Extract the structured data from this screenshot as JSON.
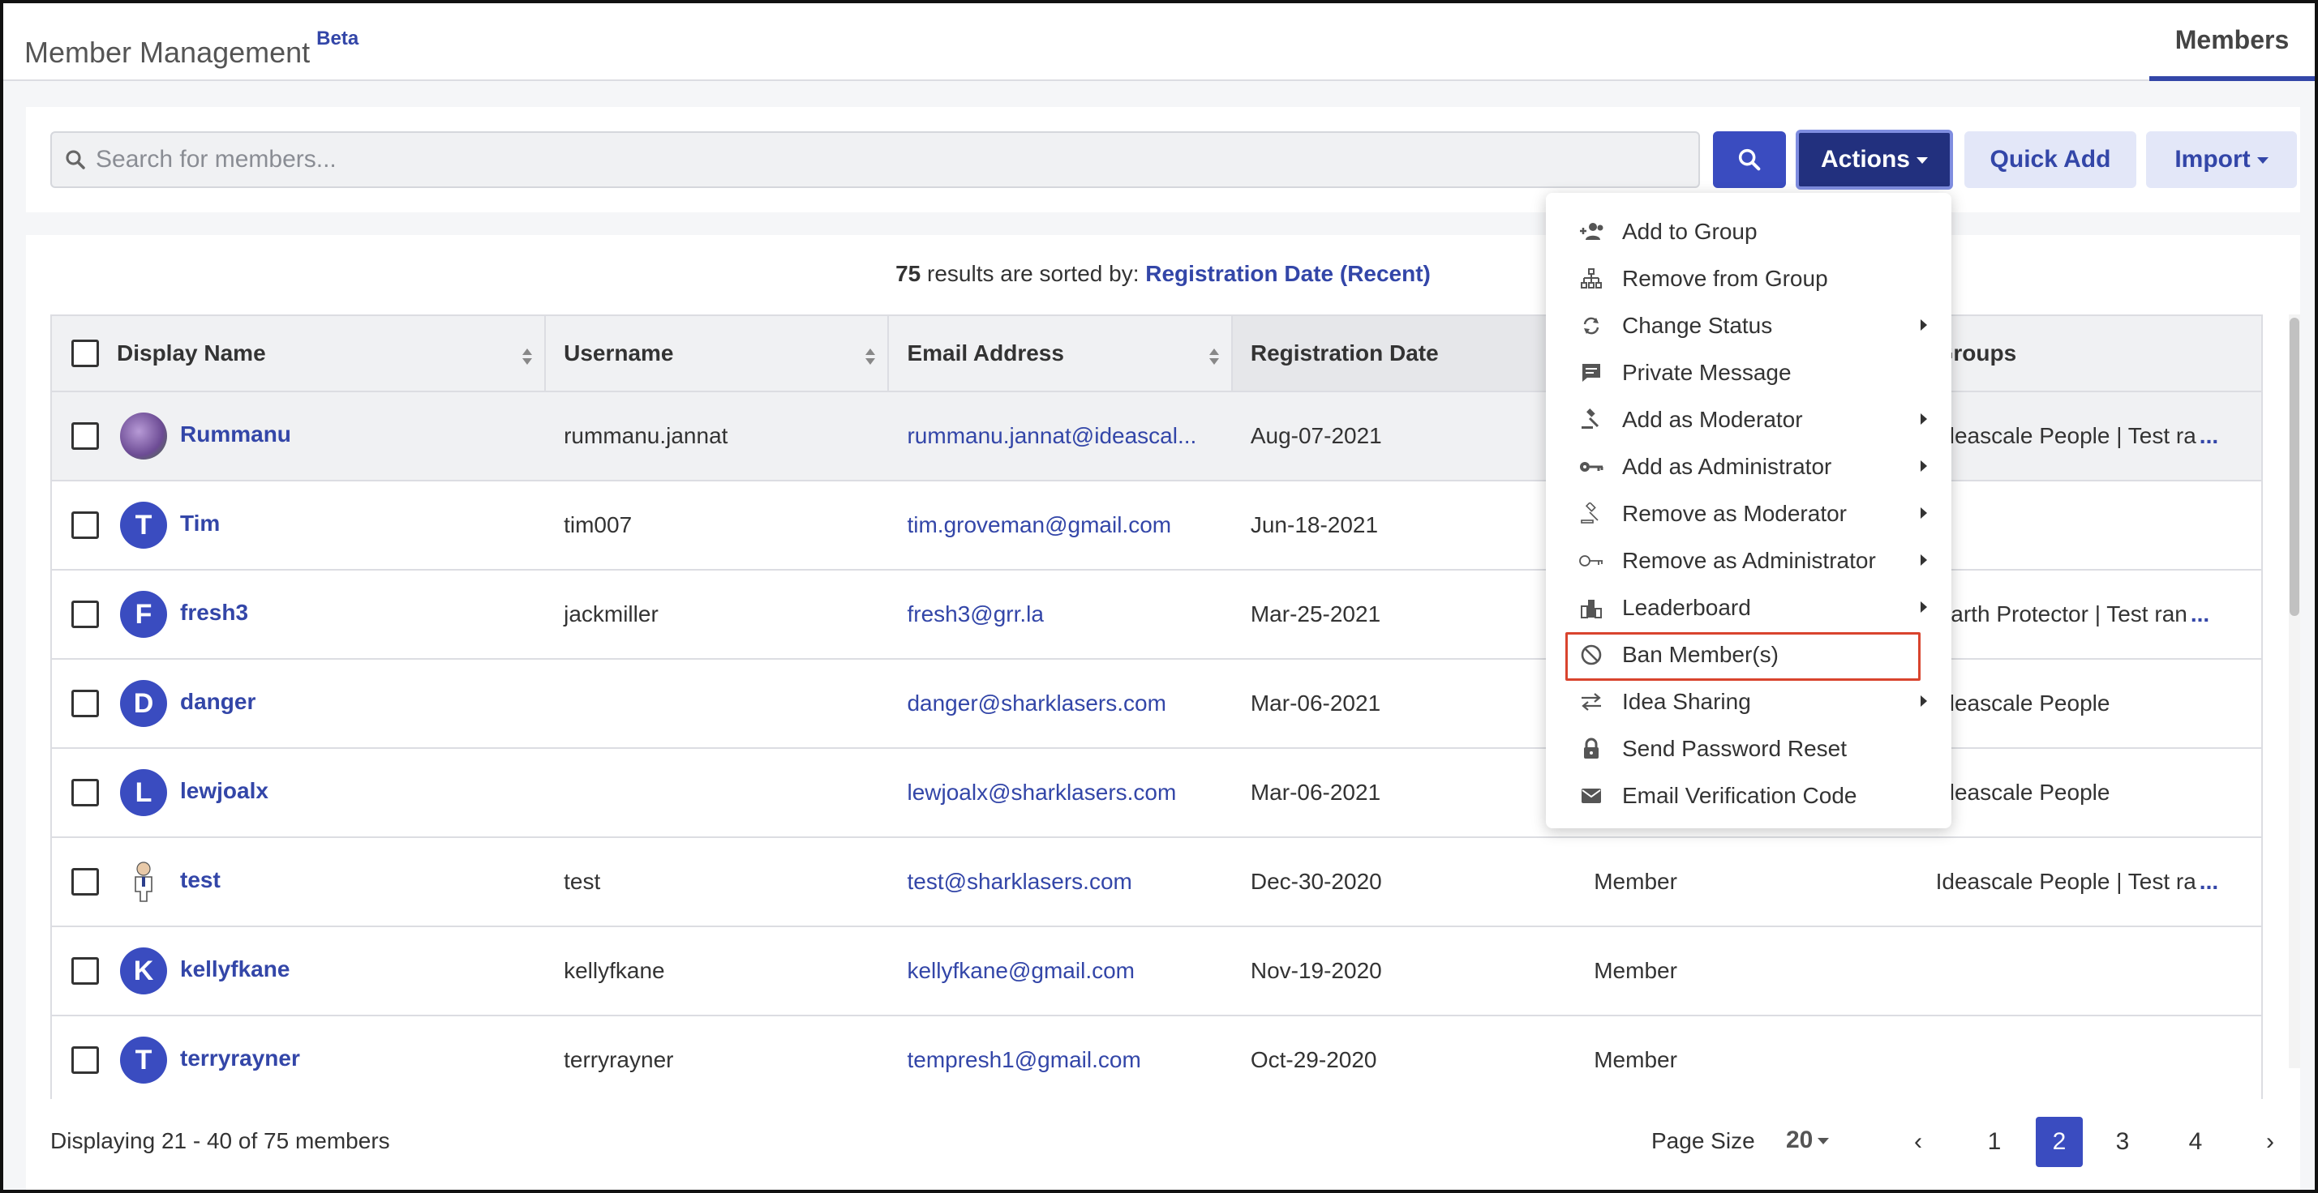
{
  "header": {
    "title": "Member Management",
    "badge": "Beta",
    "tab": "Members"
  },
  "toolbar": {
    "search_placeholder": "Search for members...",
    "actions_label": "Actions",
    "quick_add_label": "Quick Add",
    "import_label": "Import"
  },
  "summary": {
    "count": "75",
    "text": " results are sorted by: ",
    "sort": "Registration Date (Recent)"
  },
  "table": {
    "columns": [
      "Display Name",
      "Username",
      "Email Address",
      "Registration Date",
      "",
      "Groups"
    ],
    "rows": [
      {
        "avatar": "",
        "avatar_type": "photo",
        "name": "Rummanu",
        "username": "rummanu.jannat",
        "email": "rummanu.jannat@ideascal...",
        "date": "Aug-07-2021",
        "status": "",
        "groups": "Ideascale People | Test ra",
        "more": "...",
        "highlight": true
      },
      {
        "avatar": "T",
        "avatar_type": "letter",
        "name": "Tim",
        "username": "tim007",
        "email": "tim.groveman@gmail.com",
        "date": "Jun-18-2021",
        "status": "",
        "groups": "",
        "more": ""
      },
      {
        "avatar": "F",
        "avatar_type": "letter",
        "name": "fresh3",
        "username": "jackmiller",
        "email": "fresh3@grr.la",
        "date": "Mar-25-2021",
        "status": "",
        "groups": "Earth Protector | Test ran",
        "more": "..."
      },
      {
        "avatar": "D",
        "avatar_type": "letter",
        "name": "danger",
        "username": "",
        "email": "danger@sharklasers.com",
        "date": "Mar-06-2021",
        "status": "",
        "groups": "Ideascale People",
        "more": ""
      },
      {
        "avatar": "L",
        "avatar_type": "letter",
        "name": "lewjoalx",
        "username": "",
        "email": "lewjoalx@sharklasers.com",
        "date": "Mar-06-2021",
        "status": "",
        "groups": "Ideascale People",
        "more": ""
      },
      {
        "avatar": "",
        "avatar_type": "figure",
        "name": "test",
        "username": "test",
        "email": "test@sharklasers.com",
        "date": "Dec-30-2020",
        "status": "Member",
        "groups": "Ideascale People | Test ra",
        "more": "..."
      },
      {
        "avatar": "K",
        "avatar_type": "letter",
        "name": "kellyfkane",
        "username": "kellyfkane",
        "email": "kellyfkane@gmail.com",
        "date": "Nov-19-2020",
        "status": "Member",
        "groups": "",
        "more": ""
      },
      {
        "avatar": "T",
        "avatar_type": "letter",
        "name": "terryrayner",
        "username": "terryrayner",
        "email": "tempresh1@gmail.com",
        "date": "Oct-29-2020",
        "status": "Member",
        "groups": "",
        "more": ""
      }
    ]
  },
  "footer": {
    "displaying": "Displaying 21 - 40 of 75 members",
    "page_size_label": "Page Size",
    "page_size_value": "20",
    "prev": "‹",
    "next": "›",
    "pages": [
      "1",
      "2",
      "3",
      "4"
    ],
    "current_page": "2"
  },
  "actions_menu": [
    {
      "label": "Add to Group",
      "icon": "add-group-icon",
      "submenu": false
    },
    {
      "label": "Remove from Group",
      "icon": "hierarchy-icon",
      "submenu": false
    },
    {
      "label": "Change Status",
      "icon": "refresh-icon",
      "submenu": true
    },
    {
      "label": "Private Message",
      "icon": "message-icon",
      "submenu": false
    },
    {
      "label": "Add as Moderator",
      "icon": "gavel-icon",
      "submenu": true
    },
    {
      "label": "Add as Administrator",
      "icon": "key-icon",
      "submenu": true
    },
    {
      "label": "Remove as Moderator",
      "icon": "gavel-outline-icon",
      "submenu": true
    },
    {
      "label": "Remove as Administrator",
      "icon": "key-outline-icon",
      "submenu": true
    },
    {
      "label": "Leaderboard",
      "icon": "leaderboard-icon",
      "submenu": true
    },
    {
      "label": "Ban Member(s)",
      "icon": "ban-icon",
      "submenu": false,
      "selected": true
    },
    {
      "label": "Idea Sharing",
      "icon": "swap-icon",
      "submenu": true
    },
    {
      "label": "Send Password Reset",
      "icon": "lock-icon",
      "submenu": false
    },
    {
      "label": "Email Verification Code",
      "icon": "mail-icon",
      "submenu": false
    }
  ],
  "colors": {
    "primary": "#3a4cc0",
    "primary_dark": "#22307e",
    "link": "#3346a8",
    "highlight_border": "#d9442e"
  }
}
